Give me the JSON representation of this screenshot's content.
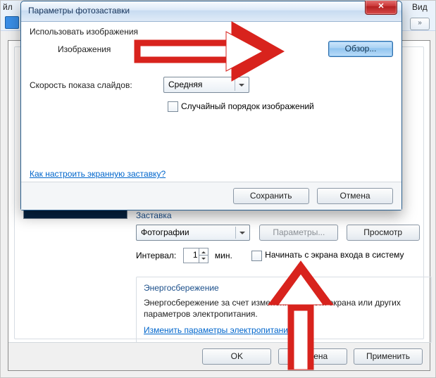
{
  "menu": {
    "file": "йл",
    "view": "Вид"
  },
  "background_dialog": {
    "saver_group_title": "Заставка",
    "saver_combo_value": "Фотографии",
    "btn_params": "Параметры...",
    "btn_preview": "Просмотр",
    "interval_label": "Интервал:",
    "interval_value": "1",
    "interval_unit": "мин.",
    "chk_on_resume": "Начинать с экрана входа в систему",
    "power_title": "Энергосбережение",
    "power_text": "Энергосбережение за счет изменения яркости экрана или других параметров электропитания.",
    "power_link": "Изменить параметры электропитания...",
    "btn_ok": "OK",
    "btn_cancel": "Отмена",
    "btn_apply": "Применить"
  },
  "modal": {
    "title": "Параметры фотозаставки",
    "use_images": "Использовать изображения",
    "images_label": "Изображения",
    "browse": "Обзор...",
    "speed_label": "Скорость показа слайдов:",
    "speed_value": "Средняя",
    "shuffle": "Случайный порядок изображений",
    "help_link": "Как настроить экранную заставку?",
    "btn_save": "Сохранить",
    "btn_cancel": "Отмена"
  },
  "colors": {
    "arrow": "#d8231d"
  }
}
